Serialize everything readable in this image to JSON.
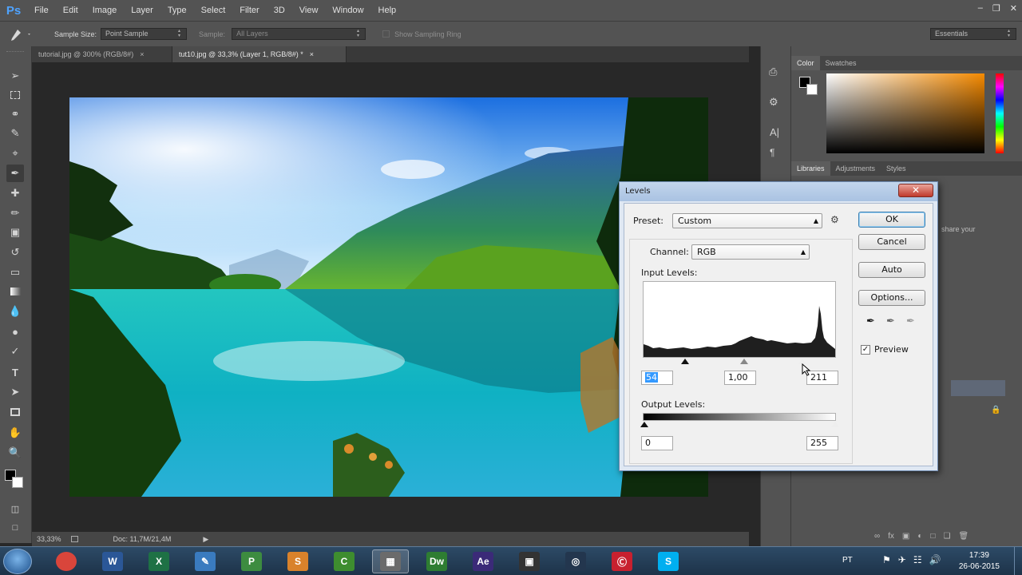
{
  "app": {
    "logo": "Ps"
  },
  "menu": [
    "File",
    "Edit",
    "Image",
    "Layer",
    "Type",
    "Select",
    "Filter",
    "3D",
    "View",
    "Window",
    "Help"
  ],
  "window_controls": [
    "–",
    "❐",
    "✕"
  ],
  "options_bar": {
    "sample_size_label": "Sample Size:",
    "sample_size_value": "Point Sample",
    "sample_label": "Sample:",
    "sample_value": "All Layers",
    "show_ring_label": "Show Sampling Ring",
    "workspace": "Essentials"
  },
  "tabs": [
    {
      "label": "tutorial.jpg @ 300% (RGB/8#)",
      "close": "×"
    },
    {
      "label": "tut10.jpg @ 33,3% (Layer 1, RGB/8#) *",
      "close": "×"
    }
  ],
  "status": {
    "zoom": "33,33%",
    "doc": "Doc: 11,7M/21,4M",
    "arrow": "▶"
  },
  "panels": {
    "color_tabs": [
      "Color",
      "Swatches"
    ],
    "lib_tabs": [
      "Libraries",
      "Adjustments",
      "Styles"
    ],
    "lib_snippet": "share your"
  },
  "dialog": {
    "title": "Levels",
    "close": "✕",
    "preset_label": "Preset:",
    "preset_value": "Custom",
    "channel_label": "Channel:",
    "channel_value": "RGB",
    "input_levels_label": "Input Levels:",
    "input_black": "54",
    "input_gamma": "1,00",
    "input_white": "211",
    "output_levels_label": "Output Levels:",
    "output_black": "0",
    "output_white": "255",
    "ok": "OK",
    "cancel": "Cancel",
    "auto": "Auto",
    "options": "Options...",
    "preview_label": "Preview",
    "preview_checked": true
  },
  "taskbar": {
    "time": "17:39",
    "date": "26-06-2015",
    "lang": "PT",
    "apps": [
      {
        "name": "chrome",
        "label": "",
        "color": "#d9453b"
      },
      {
        "name": "word",
        "label": "W",
        "color": "#2b5797"
      },
      {
        "name": "excel",
        "label": "X",
        "color": "#1e7145"
      },
      {
        "name": "notepad",
        "label": "✎",
        "color": "#3a7bbf"
      },
      {
        "name": "publisher",
        "label": "P",
        "color": "#3d8c40"
      },
      {
        "name": "sublime",
        "label": "S",
        "color": "#d9822b"
      },
      {
        "name": "camtasia",
        "label": "C",
        "color": "#3e8d2f"
      },
      {
        "name": "calculator",
        "label": "▦",
        "color": "#6b6b6b"
      },
      {
        "name": "dreamweaver",
        "label": "Dw",
        "color": "#2e7d32"
      },
      {
        "name": "aftereffects",
        "label": "Ae",
        "color": "#3b2a78"
      },
      {
        "name": "filmstrip",
        "label": "▣",
        "color": "#333333"
      },
      {
        "name": "cinema4d",
        "label": "◎",
        "color": "#23364e"
      },
      {
        "name": "creativecloud",
        "label": "Ⓒ",
        "color": "#c8202f"
      },
      {
        "name": "skype",
        "label": "S",
        "color": "#00aff0"
      }
    ]
  }
}
